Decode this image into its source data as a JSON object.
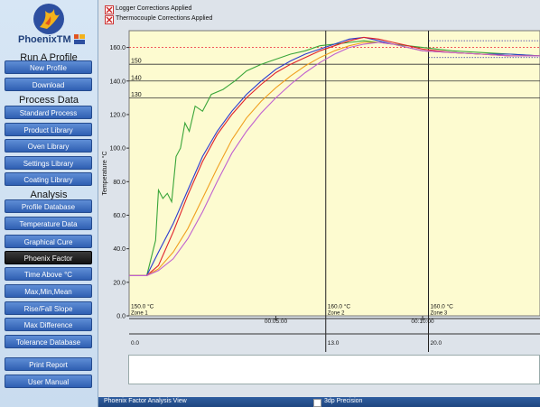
{
  "sidebar": {
    "brand": "PhoenixTM",
    "sections": [
      {
        "label": "Run A Profile"
      },
      {
        "label": "Process Data"
      },
      {
        "label": "Analysis"
      }
    ],
    "buttons": [
      {
        "label": "New Profile"
      },
      {
        "label": "Download"
      },
      {
        "label": "Standard Process"
      },
      {
        "label": "Product Library"
      },
      {
        "label": "Oven Library"
      },
      {
        "label": "Settings Library"
      },
      {
        "label": "Coating Library"
      },
      {
        "label": "Profile Database"
      },
      {
        "label": "Temperature Data"
      },
      {
        "label": "Graphical Cure"
      },
      {
        "label": "Phoenix Factor"
      },
      {
        "label": "Time Above °C"
      },
      {
        "label": "Max,Min,Mean"
      },
      {
        "label": "Rise/Fall Slope"
      },
      {
        "label": "Max Difference"
      },
      {
        "label": "Tolerance Database"
      },
      {
        "label": "Print Report"
      },
      {
        "label": "User Manual"
      }
    ],
    "active_button": "Phoenix Factor"
  },
  "options": {
    "logger_corrections": "Logger Corrections Applied",
    "thermocouple_corrections": "Thermocouple Corrections Applied"
  },
  "chart_data": {
    "type": "line",
    "ylabel": "Temperature °C",
    "ylim": [
      0,
      170
    ],
    "yticks": [
      "0.0",
      "20.0",
      "40.0",
      "60.0",
      "80.0",
      "100.0",
      "120.0",
      "140.0",
      "160.0"
    ],
    "x_time_ticks": [
      "00:05:00",
      "00:10:00"
    ],
    "x_distance_ticks": [
      "0.0",
      "13.0",
      "20.0"
    ],
    "reference_lines": [
      {
        "label": "150",
        "y": 150
      },
      {
        "label": "140",
        "y": 140
      },
      {
        "label": "130",
        "y": 130
      }
    ],
    "zones": [
      {
        "temp": "150.0 °C",
        "name": "Zone 1"
      },
      {
        "temp": "160.0 °C",
        "name": "Zone 2"
      },
      {
        "temp": "160.0 °C",
        "name": "Zone 3"
      }
    ],
    "zone_boundaries_min": [
      0,
      6.7,
      10.2
    ],
    "x_range_min": [
      0,
      14
    ],
    "upper_limit": 160,
    "grid": false,
    "series": [
      {
        "color": "#3aa53a",
        "x": [
          0,
          0.6,
          0.9,
          1.0,
          1.15,
          1.3,
          1.45,
          1.6,
          1.75,
          1.9,
          2.05,
          2.25,
          2.5,
          2.8,
          3.2,
          3.6,
          4.0,
          4.5,
          5.0,
          5.5,
          6.0,
          6.5,
          7.0,
          7.5,
          8.0,
          8.5,
          9.0,
          9.5,
          10.0,
          11,
          12,
          13,
          14
        ],
        "y": [
          24,
          24,
          45,
          75,
          70,
          73,
          68,
          95,
          100,
          115,
          110,
          125,
          122,
          132,
          135,
          140,
          146,
          150,
          153,
          156,
          158,
          161,
          162,
          163,
          164,
          163,
          162,
          161,
          160,
          158,
          157,
          156,
          155
        ]
      },
      {
        "color": "#2a3ad0",
        "x": [
          0,
          0.6,
          1.0,
          1.5,
          2.0,
          2.5,
          3.0,
          3.5,
          4.0,
          4.5,
          5.0,
          5.5,
          6.0,
          6.5,
          7.0,
          7.5,
          8.0,
          8.5,
          9.0,
          9.5,
          10.0,
          11,
          12,
          13,
          14
        ],
        "y": [
          24,
          24,
          38,
          55,
          75,
          95,
          110,
          122,
          132,
          140,
          147,
          152,
          156,
          159,
          162,
          165,
          166,
          164,
          162,
          160,
          158,
          157,
          156,
          156,
          155
        ]
      },
      {
        "color": "#e0202a",
        "x": [
          0,
          0.6,
          1.0,
          1.5,
          2.0,
          2.5,
          3.0,
          3.5,
          4.0,
          4.5,
          5.0,
          5.5,
          6.0,
          6.5,
          7.0,
          7.5,
          8.0,
          8.5,
          9.0,
          9.5,
          10.0,
          11,
          12,
          13,
          14
        ],
        "y": [
          24,
          24,
          30,
          50,
          72,
          92,
          108,
          120,
          130,
          138,
          145,
          150,
          154,
          158,
          161,
          164,
          166,
          165,
          163,
          161,
          159,
          157,
          156,
          155,
          155
        ]
      },
      {
        "color": "#f0a020",
        "x": [
          0,
          0.6,
          1.0,
          1.5,
          2.0,
          2.5,
          3.0,
          3.5,
          4.0,
          4.5,
          5.0,
          5.5,
          6.0,
          6.5,
          7.0,
          7.5,
          8.0,
          8.5,
          9.0,
          9.5,
          10.0,
          11,
          12,
          13,
          14
        ],
        "y": [
          24,
          24,
          28,
          38,
          52,
          70,
          88,
          105,
          118,
          128,
          136,
          143,
          149,
          154,
          158,
          161,
          163,
          163,
          162,
          160,
          158,
          157,
          156,
          155,
          155
        ]
      },
      {
        "color": "#c060d0",
        "x": [
          0,
          0.6,
          1.0,
          1.5,
          2.0,
          2.5,
          3.0,
          3.5,
          4.0,
          4.5,
          5.0,
          5.5,
          6.0,
          6.5,
          7.0,
          7.5,
          8.0,
          8.5,
          9.0,
          9.5,
          10.0,
          11,
          12,
          13,
          14
        ],
        "y": [
          24,
          24,
          27,
          34,
          46,
          62,
          80,
          97,
          110,
          121,
          130,
          138,
          145,
          151,
          156,
          160,
          162,
          163,
          162,
          160,
          158,
          157,
          156,
          155,
          155
        ]
      }
    ]
  },
  "bottom_panel": {
    "title": "Phoenix Factor Analysis View",
    "precision_label": "3dp Precision"
  }
}
